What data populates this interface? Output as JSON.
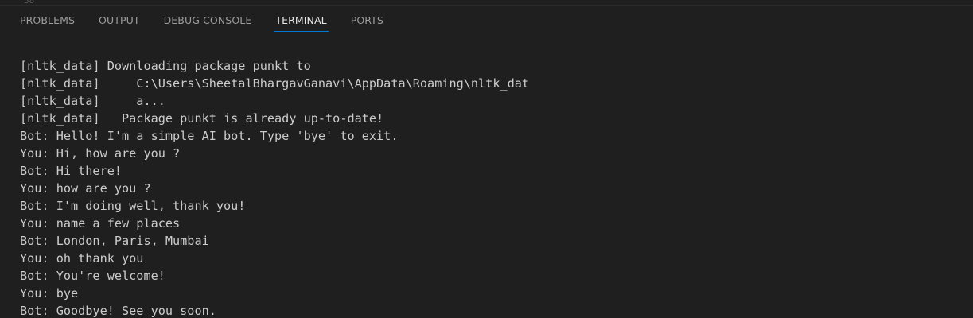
{
  "tabs": [
    {
      "label": "PROBLEMS"
    },
    {
      "label": "OUTPUT"
    },
    {
      "label": "DEBUG CONSOLE"
    },
    {
      "label": "TERMINAL",
      "active": true
    },
    {
      "label": "PORTS"
    }
  ],
  "colors": {
    "background": "#1f1f1f",
    "text": "#cccccc",
    "active_tab_underline": "#0078d4"
  },
  "terminal": {
    "lines": [
      "[nltk_data] Downloading package punkt to",
      "[nltk_data]     C:\\Users\\SheetalBhargavGanavi\\AppData\\Roaming\\nltk_dat",
      "[nltk_data]     a...",
      "[nltk_data]   Package punkt is already up-to-date!",
      "Bot: Hello! I'm a simple AI bot. Type 'bye' to exit.",
      "You: Hi, how are you ?",
      "Bot: Hi there!",
      "You: how are you ?",
      "Bot: I'm doing well, thank you!",
      "You: name a few places",
      "Bot: London, Paris, Mumbai",
      "You: oh thank you",
      "Bot: You're welcome!",
      "You: bye",
      "Bot: Goodbye! See you soon."
    ]
  }
}
